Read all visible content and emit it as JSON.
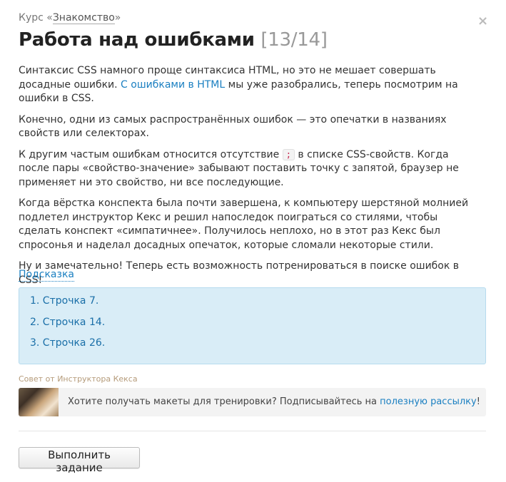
{
  "course": {
    "prefix": "Курс «",
    "name": "Знакомство",
    "suffix": "»"
  },
  "close_glyph": "×",
  "title": {
    "text": "Работа над ошибками",
    "counter": "[13/14]"
  },
  "paragraphs": {
    "p1_before": "Синтаксис CSS намного проще синтаксиса HTML, но это не мешает совершать досадные ошибки. ",
    "p1_link": "С ошибками в HTML",
    "p1_after": " мы уже разобрались, теперь посмотрим на ошибки в CSS.",
    "p2": "Конечно, одни из самых распространённых ошибок — это опечатки в названиях свойств или селекторах.",
    "p3_before": "К другим частым ошибкам относится отсутствие ",
    "p3_code": ";",
    "p3_after": " в списке CSS-свойств. Когда после пары «свойство-значение» забывают поставить точку с запятой, браузер не применяет ни это свойство, ни все последующие.",
    "p4": "Когда вёрстка конспекта была почти завершена, к компьютеру шерстяной молнией подлетел инструктор Кекс и решил напоследок поиграться со стилями, чтобы сделать конспект «симпатичнее». Получилось неплохо, но в этот раз Кекс был спросонья и наделал досадных опечаток, которые сломали некоторые стили.",
    "p5": "Ну и замечательно! Теперь есть возможность потренироваться в поиске ошибок в CSS!"
  },
  "hint": {
    "toggle_label": "Подсказка",
    "items": [
      "1. Строчка 7.",
      "2. Строчка 14.",
      "3. Строчка 26."
    ]
  },
  "tip": {
    "caption": "Совет от Инструктора Кекса",
    "text_before": "Хотите получать макеты для тренировки? Подписывайтесь на ",
    "link": "полезную рассылку",
    "text_after": "!"
  },
  "submit_label": "Выполнить задание"
}
